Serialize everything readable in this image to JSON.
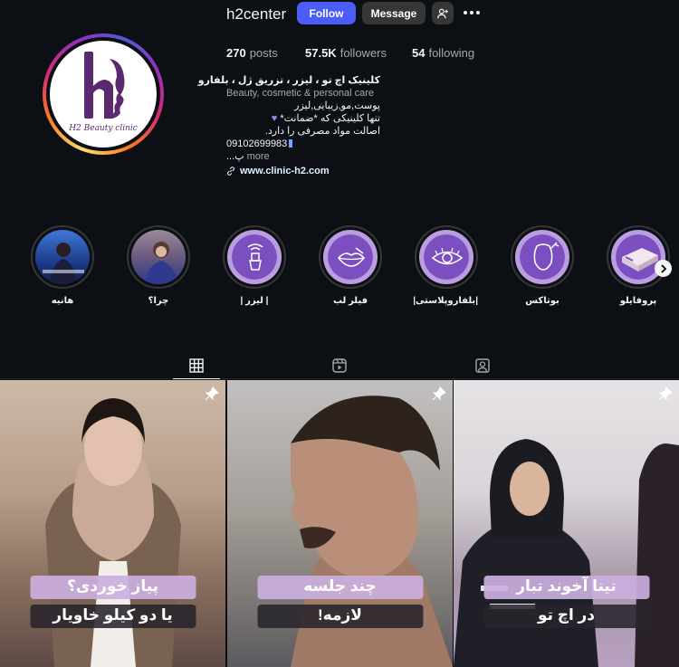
{
  "profile": {
    "username": "h2center",
    "avatar_caption": "H2 Beauty clinic",
    "follow_label": "Follow",
    "message_label": "Message",
    "stats": {
      "posts_value": "270",
      "posts_label": "posts",
      "followers_value": "57.5K",
      "followers_label": "followers",
      "following_value": "54",
      "following_label": "following"
    },
    "bio": {
      "name": "کلینیک اچ تو ، لیزر ، تزریق ژل ، بلفارو",
      "category": "Beauty, cosmetic & personal care",
      "line1": "پوست,مو,زیبایی,لیزر",
      "line2": "تنها کلینیکی که *ضمانت*",
      "line3": "اصالت مواد مصرفی را دارد.",
      "phone": "09102699983",
      "truncated": "...پ",
      "more": "more",
      "link": "www.clinic-h2.com"
    }
  },
  "highlights": [
    {
      "label": "هانیه",
      "style": "photo1",
      "icon": "photo"
    },
    {
      "label": "چرا؟",
      "style": "photo2",
      "icon": "photo"
    },
    {
      "label": "| لیزر |",
      "style": "purple",
      "icon": "laser-icon"
    },
    {
      "label": "فیلر لب",
      "style": "purple",
      "icon": "lips-icon"
    },
    {
      "label": "|بلفاروپلاستی|",
      "style": "purple",
      "icon": "eye-icon"
    },
    {
      "label": "بوتاکس",
      "style": "purple",
      "icon": "botox-face-icon"
    },
    {
      "label": "پروفایلو",
      "style": "purple",
      "icon": "product-box-icon"
    }
  ],
  "tabs": [
    {
      "name": "posts",
      "icon": "grid-icon",
      "active": true
    },
    {
      "name": "reels",
      "icon": "reels-icon",
      "active": false
    },
    {
      "name": "tagged",
      "icon": "tagged-icon",
      "active": false
    }
  ],
  "posts": [
    {
      "top_text": "پیاز خوردی؟",
      "bottom_text": "یا دو کیلو خاویار",
      "pinned": true
    },
    {
      "top_text": "چند جلسه",
      "bottom_text": "لازمه!",
      "pinned": true
    },
    {
      "top_text": "تینا آخوند تبار",
      "bottom_text": "در اچ تو",
      "pinned": true
    }
  ],
  "colors": {
    "background": "#0c1014",
    "follow_button": "#4a5df9",
    "secondary_button": "#363636",
    "highlight_purple": "#7b4fbf",
    "caption_lilac": "#cbafde"
  }
}
